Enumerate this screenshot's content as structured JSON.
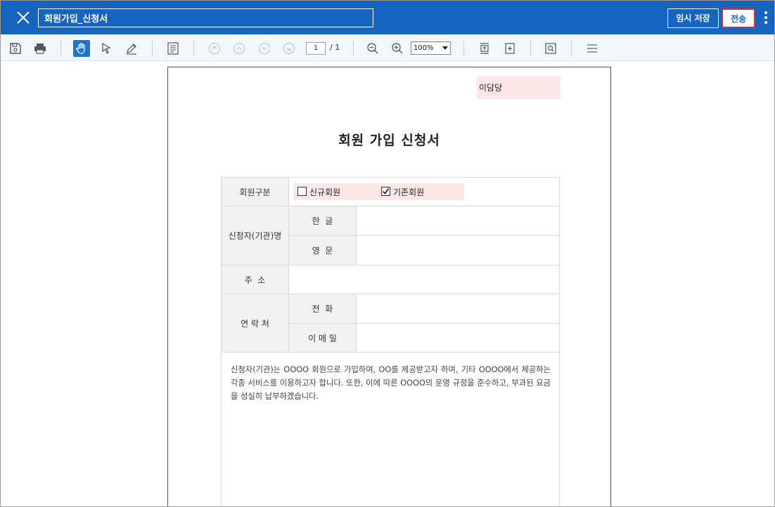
{
  "header": {
    "title": "회원가입_신청서",
    "temp_save_label": "임시 저장",
    "send_label": "전송"
  },
  "toolbar": {
    "icons": [
      "save-icon",
      "print-icon",
      "hand-tool-icon",
      "select-arrow-icon",
      "pen-icon",
      "form-icon",
      "first-page-icon",
      "prev-page-icon",
      "next-page-icon",
      "last-page-icon",
      "zoom-out-icon",
      "zoom-in-icon",
      "fit-page-icon",
      "fit-width-icon",
      "find-icon",
      "menu-icon"
    ],
    "page_current": "1",
    "page_total": "/ 1",
    "zoom": "100%"
  },
  "document": {
    "assignee": "이담당",
    "title": "회원 가입 신청서",
    "member_type_label": "회원구분",
    "option_new": "신규회원",
    "option_existing": "기존회원",
    "option_new_checked": false,
    "option_existing_checked": true,
    "applicant_label": "신청자(기관)명",
    "korean_label": "한  글",
    "english_label": "영  문",
    "address_label": "주  소",
    "contact_label": "연 락 처",
    "phone_label": "전  화",
    "email_label": "이 메 일",
    "agreement_text": "신청자(기관)는 OOOO 회원으로 가입하여, OO를 제공받고자 하며, 기타 OOOO에서 제공하는 각종 서비스를 이용하고자 합니다. 또한, 이에 따른 OOOO의 운영 규정을 준수하고, 부과된 요금을 성실히 납부하겠습니다."
  },
  "colors": {
    "header_bg": "#1565c0",
    "send_border": "#d32f2f",
    "highlight": "#fde6e6",
    "label_bg": "#f2f2f2"
  }
}
